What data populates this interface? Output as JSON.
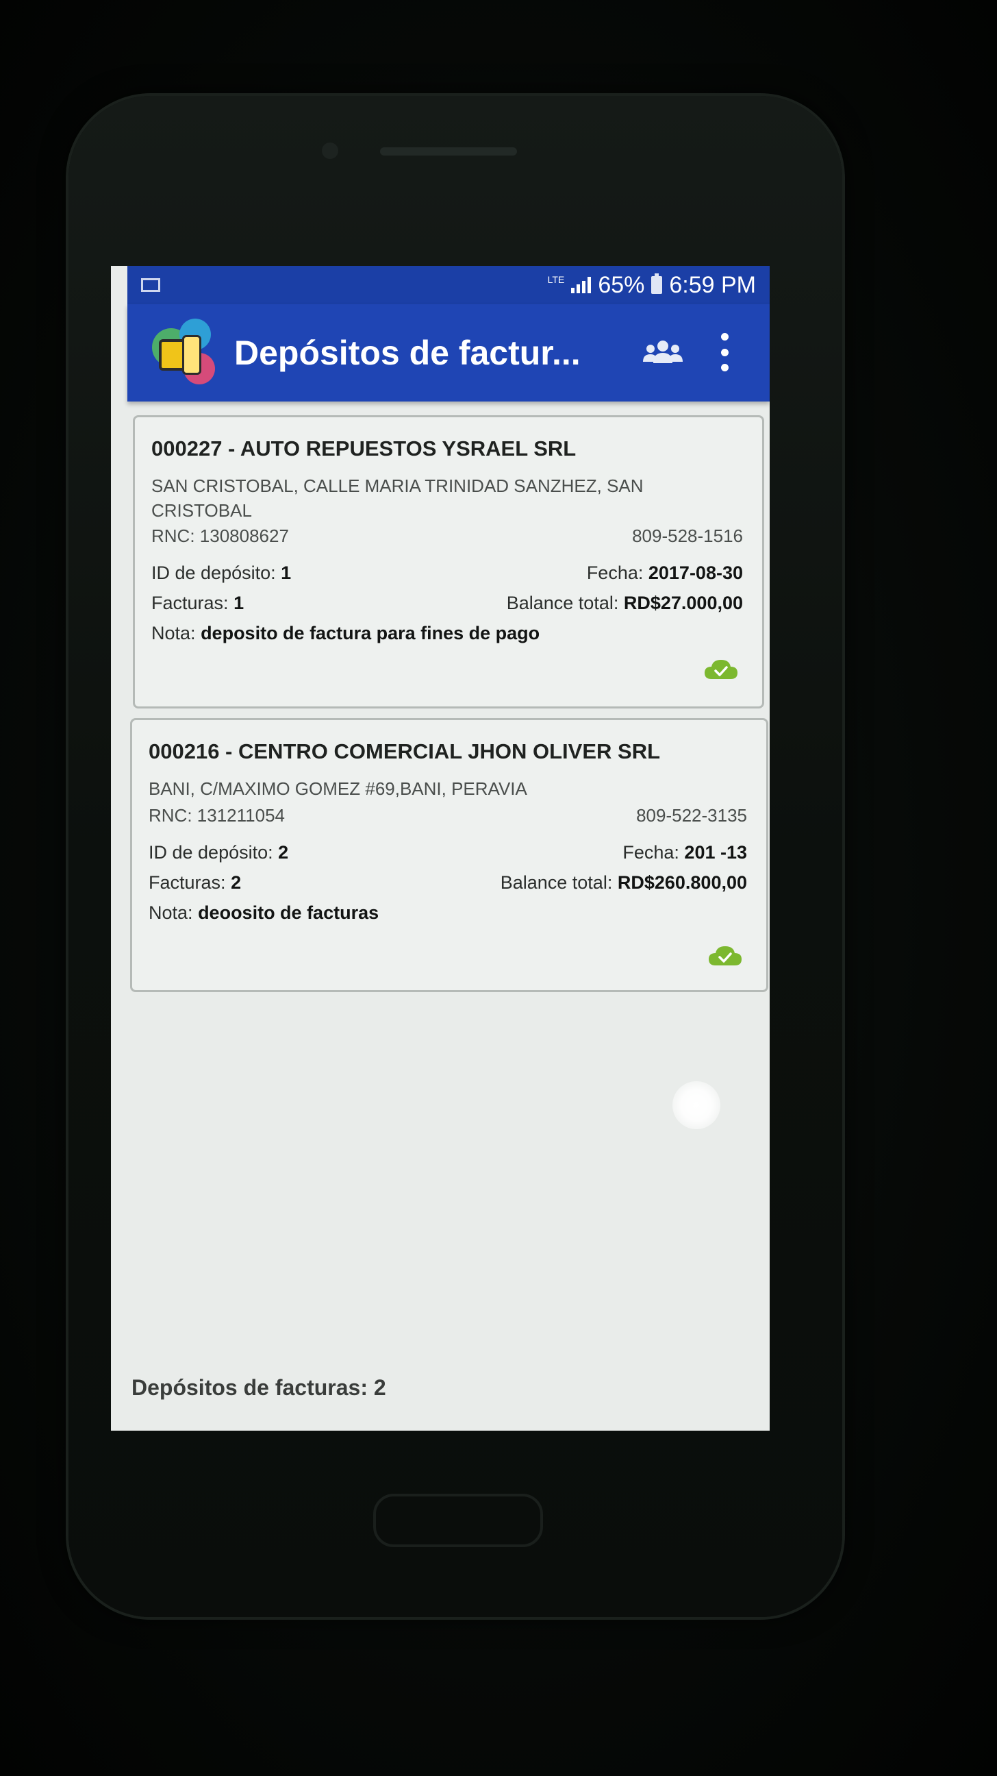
{
  "status_bar": {
    "network": "LTE",
    "battery": "65%",
    "time": "6:59 PM"
  },
  "app_bar": {
    "title": "Depósitos de factur..."
  },
  "deposits": [
    {
      "header": "000227 - AUTO REPUESTOS YSRAEL SRL",
      "address": "SAN CRISTOBAL, CALLE MARIA TRINIDAD SANZHEZ, SAN CRISTOBAL",
      "rnc": "RNC: 130808627",
      "phone": "809-528-1516",
      "deposit_id_label": "ID de depósito:",
      "deposit_id": "1",
      "date_label": "Fecha:",
      "date": "2017-08-30",
      "invoices_label": "Facturas:",
      "invoices": "1",
      "balance_label": "Balance total:",
      "balance": "RD$27.000,00",
      "note_label": "Nota:",
      "note": "deposito de factura para fines de pago",
      "sync_icon": "cloud-check-icon"
    },
    {
      "header": "000216 - CENTRO COMERCIAL JHON OLIVER SRL",
      "address": "BANI, C/MAXIMO GOMEZ #69,BANI, PERAVIA",
      "rnc": "RNC: 131211054",
      "phone": "809-522-3135",
      "deposit_id_label": "ID de depósito:",
      "deposit_id": "2",
      "date_label": "Fecha:",
      "date": "201 -13",
      "invoices_label": "Facturas:",
      "invoices": "2",
      "balance_label": "Balance total:",
      "balance": "RD$260.800,00",
      "note_label": "Nota:",
      "note": "deoosito de facturas",
      "sync_icon": "cloud-check-icon"
    }
  ],
  "footer": {
    "label": "Depósitos de facturas:",
    "count": "2"
  },
  "colors": {
    "app_bar": "#1f45b4",
    "status_bar": "#1b3fa6",
    "sync_ok": "#7cb82f"
  }
}
